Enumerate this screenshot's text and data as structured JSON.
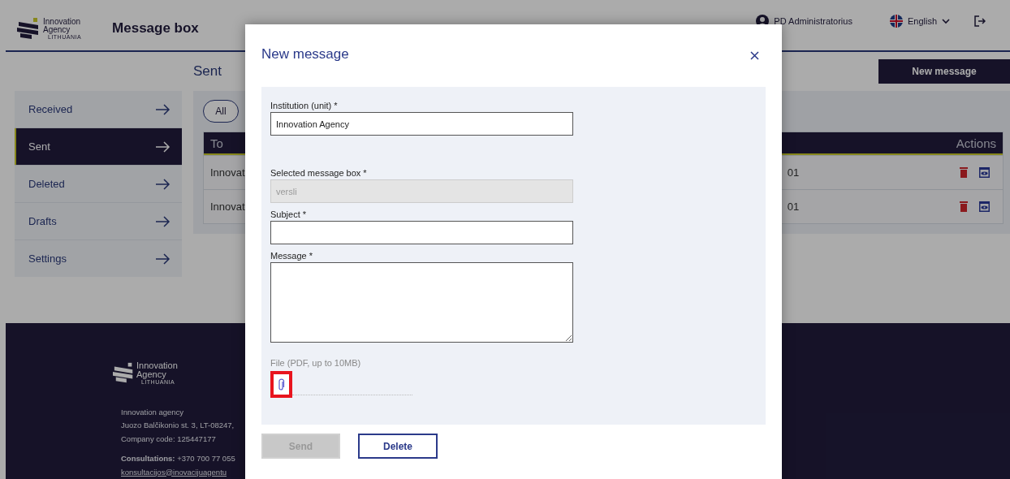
{
  "header": {
    "logo": [
      "Innovation",
      "Agency",
      "LITHUANIA"
    ],
    "title": "Message box",
    "user": "PD Administratorius",
    "language": "English"
  },
  "page": {
    "heading": "Sent",
    "new_message_button": "New message"
  },
  "sidebar": {
    "items": [
      {
        "label": "Received",
        "selected": false
      },
      {
        "label": "Sent",
        "selected": true
      },
      {
        "label": "Deleted",
        "selected": false
      },
      {
        "label": "Drafts",
        "selected": false
      },
      {
        "label": "Settings",
        "selected": false
      }
    ]
  },
  "filters": [
    {
      "label": "All"
    }
  ],
  "table": {
    "columns": [
      "To",
      "Actions"
    ],
    "rows": [
      {
        "to": "Innovat",
        "column_2": "01"
      },
      {
        "to": "Innovat",
        "column_2": "01"
      }
    ]
  },
  "footer": {
    "logo": [
      "Innovation",
      "Agency",
      "LITHUANIA"
    ],
    "lines": [
      "Innovation agency",
      "Juozo Balčikonio st. 3, LT-08247,",
      "Company code: 125447177"
    ],
    "consultations": "**Consultations:** +370 700 77 055",
    "email": "konsultacijos@inovacijuagentu"
  },
  "modal": {
    "title": "New message",
    "fields": [
      {
        "kind": "text",
        "label": "Institution (unit) *",
        "value": "Innovation Agency"
      },
      {
        "kind": "readonly",
        "label": "Selected message box *",
        "value": "versli"
      },
      {
        "kind": "text",
        "label": "Subject *"
      },
      {
        "kind": "textarea",
        "label": "Message *"
      }
    ],
    "file": {
      "label": "File (PDF, up to 10MB)",
      "highlighted": true
    },
    "buttons": [
      {
        "label": "Send",
        "disabled": true
      },
      {
        "label": "Delete",
        "disabled": false
      }
    ]
  }
}
